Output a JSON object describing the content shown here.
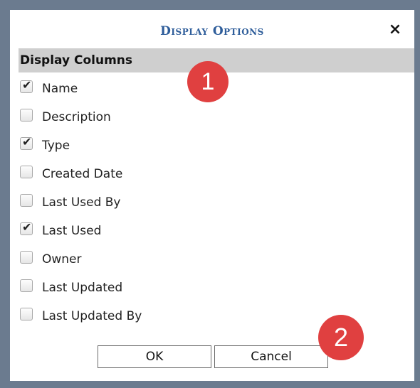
{
  "dialog": {
    "title": "Display Options",
    "close_glyph": "×",
    "section_header": "Display Columns",
    "columns": [
      {
        "label": "Name",
        "checked": true
      },
      {
        "label": "Description",
        "checked": false
      },
      {
        "label": "Type",
        "checked": true
      },
      {
        "label": "Created Date",
        "checked": false
      },
      {
        "label": "Last Used By",
        "checked": false
      },
      {
        "label": "Last Used",
        "checked": true
      },
      {
        "label": "Owner",
        "checked": false
      },
      {
        "label": "Last Updated",
        "checked": false
      },
      {
        "label": "Last Updated By",
        "checked": false
      }
    ],
    "ok_label": "OK",
    "cancel_label": "Cancel"
  },
  "annotations": {
    "badge1": "1",
    "badge2": "2",
    "color": "#e04040"
  },
  "icons": {
    "close": "close-icon",
    "check": "checkmark-icon"
  }
}
